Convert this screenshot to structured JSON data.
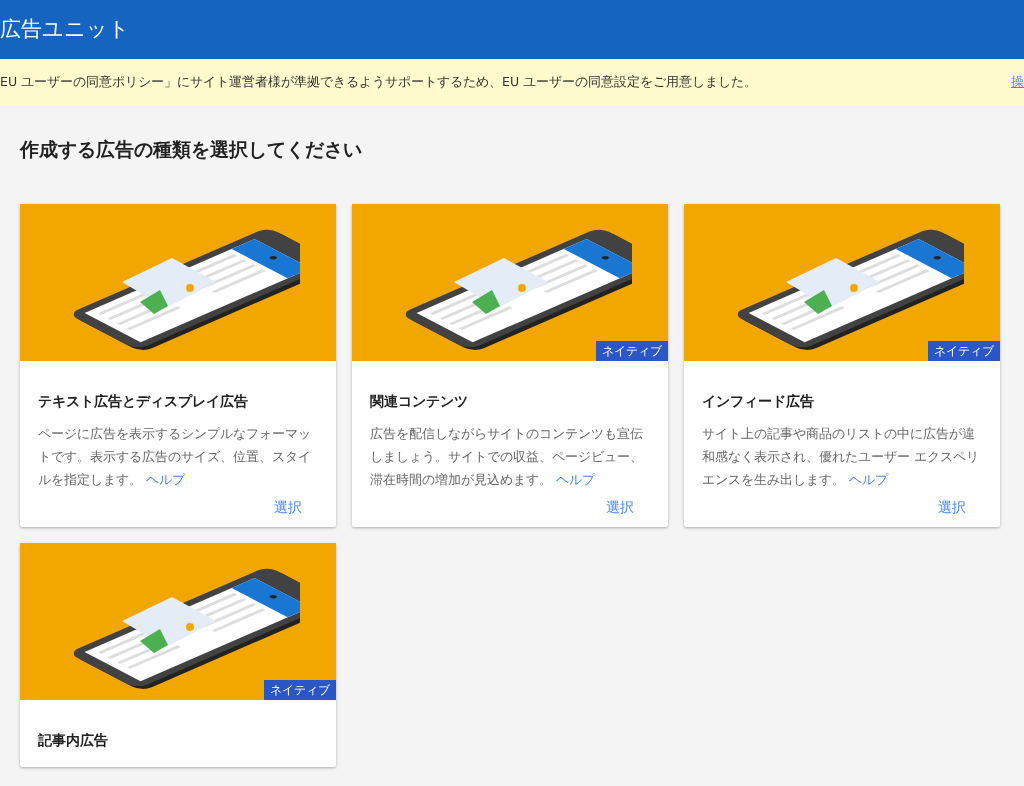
{
  "header": {
    "title": "広告ユニット"
  },
  "notice": {
    "text": "EU ユーザーの同意ポリシー」にサイト運営者様が準拠できるようサポートするため、EU ユーザーの同意設定をご用意しました。",
    "action": "操"
  },
  "heading": "作成する広告の種類を選択してください",
  "cards": [
    {
      "title": "テキスト広告とディスプレイ広告",
      "description": "ページに広告を表示するシンプルなフォーマットです。表示する広告のサイズ、位置、スタイルを指定します。",
      "help": "ヘルプ",
      "action": "選択"
    },
    {
      "title": "関連コンテンツ",
      "badge": "ネイティブ",
      "description": "広告を配信しながらサイトのコンテンツも宣伝しましょう。サイトでの収益、ページビュー、滞在時間の増加が見込めます。",
      "help": "ヘルプ",
      "action": "選択"
    },
    {
      "title": "インフィード広告",
      "badge": "ネイティブ",
      "description": "サイト上の記事や商品のリストの中に広告が違和感なく表示され、優れたユーザー エクスペリエンスを生み出します。",
      "help": "ヘルプ",
      "action": "選択"
    },
    {
      "title": "記事内広告",
      "badge": "ネイティブ"
    }
  ]
}
